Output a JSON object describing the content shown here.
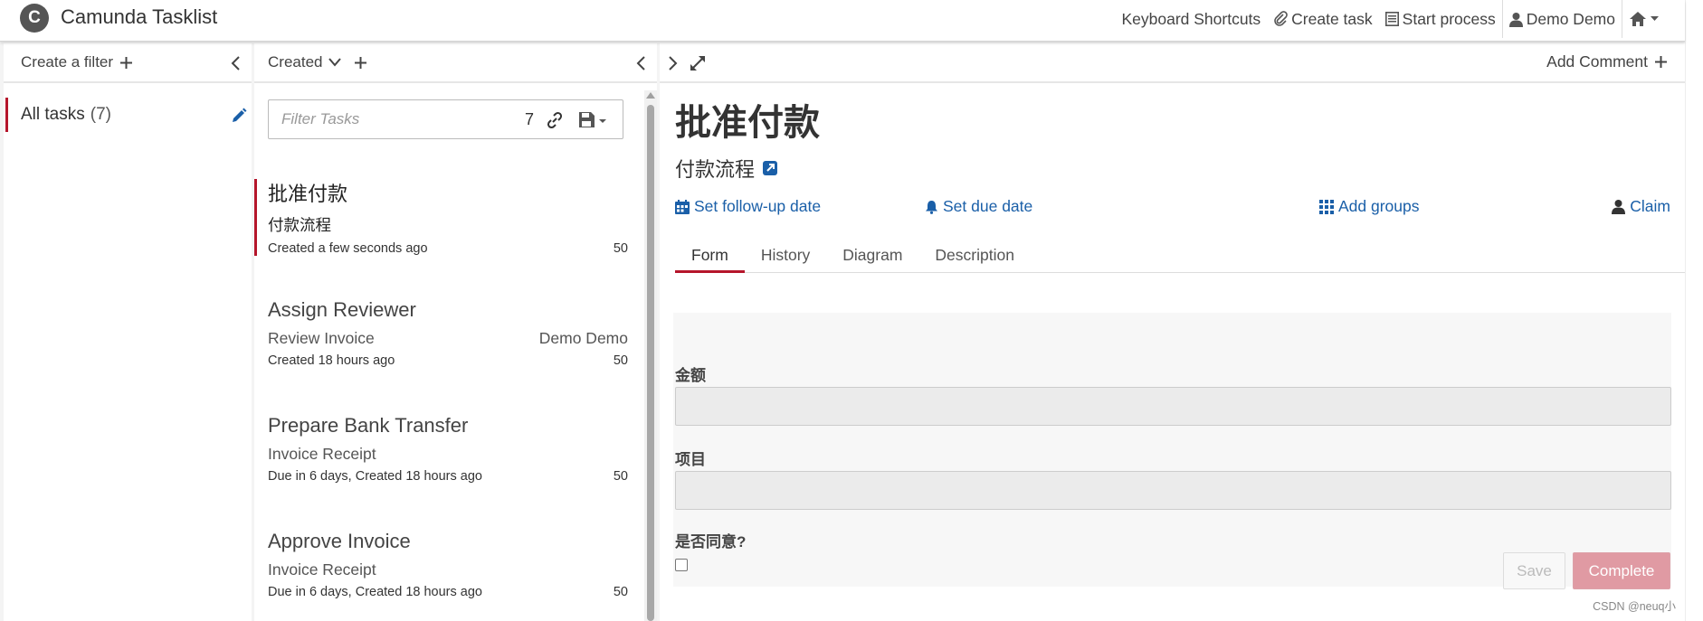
{
  "header": {
    "logo_letter": "C",
    "app_title": "Camunda Tasklist",
    "nav": {
      "keyboard_shortcuts": "Keyboard Shortcuts",
      "create_task": "Create task",
      "start_process": "Start process",
      "user": "Demo Demo"
    }
  },
  "filters": {
    "create_label": "Create a filter",
    "items": [
      {
        "label": "All tasks",
        "count": "(7)"
      }
    ]
  },
  "task_list": {
    "sort_label": "Created",
    "search": {
      "placeholder": "Filter Tasks",
      "count": "7"
    },
    "tasks": [
      {
        "name": "批准付款",
        "process": "付款流程",
        "assignee": "",
        "meta": "Created a few seconds ago",
        "priority": "50"
      },
      {
        "name": "Assign Reviewer",
        "process": "Review Invoice",
        "assignee": "Demo Demo",
        "meta": "Created 18 hours ago",
        "priority": "50"
      },
      {
        "name": "Prepare Bank Transfer",
        "process": "Invoice Receipt",
        "assignee": "",
        "meta": "Due in 6 days, Created 18 hours ago",
        "priority": "50"
      },
      {
        "name": "Approve Invoice",
        "process": "Invoice Receipt",
        "assignee": "",
        "meta": "Due in 6 days, Created 18 hours ago",
        "priority": "50"
      }
    ]
  },
  "detail": {
    "add_comment": "Add Comment",
    "title": "批准付款",
    "process_name": "付款流程",
    "actions": {
      "follow_up": "Set follow-up date",
      "due_date": "Set due date",
      "add_groups": "Add groups",
      "claim": "Claim"
    },
    "tabs": [
      "Form",
      "History",
      "Diagram",
      "Description"
    ],
    "form": {
      "fields": [
        {
          "label": "金额",
          "value": ""
        },
        {
          "label": "项目",
          "value": ""
        }
      ],
      "checkbox_label": "是否同意?",
      "save_label": "Save",
      "complete_label": "Complete"
    }
  },
  "watermark": "CSDN @neuq小",
  "colors": {
    "accent": "#b5152b",
    "link": "#1a5fa8",
    "complete_disabled": "#e09aa3"
  }
}
